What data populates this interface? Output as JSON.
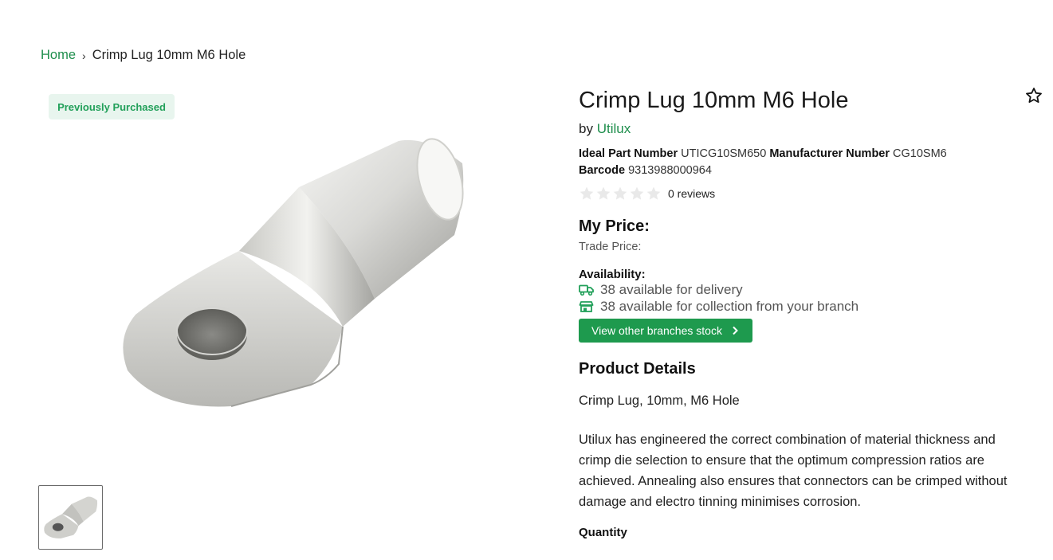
{
  "breadcrumb": {
    "home": "Home",
    "separator": "›",
    "current": "Crimp Lug 10mm M6 Hole"
  },
  "badge": "Previously Purchased",
  "product": {
    "title": "Crimp Lug 10mm M6 Hole",
    "by_prefix": "by",
    "brand": "Utilux",
    "ideal_part_label": "Ideal Part Number",
    "ideal_part_value": "UTICG10SM650",
    "manufacturer_label": "Manufacturer Number",
    "manufacturer_value": "CG10SM6",
    "barcode_label": "Barcode",
    "barcode_value": "9313988000964",
    "rating_stars": 0,
    "reviews": "0 reviews"
  },
  "pricing": {
    "my_price": "My Price:",
    "trade_price": "Trade Price:"
  },
  "availability": {
    "heading": "Availability:",
    "delivery": "38 available for delivery",
    "collection": "38 available for collection from your branch",
    "button": "View other branches stock"
  },
  "details": {
    "heading": "Product Details",
    "short": "Crimp Lug, 10mm, M6 Hole",
    "long": "Utilux has engineered the correct combination of material thickness and crimp die selection to ensure that the optimum compression ratios are achieved. Annealing also ensures that connectors can be crimped without damage and electro tinning minimises corrosion."
  },
  "quantity_label": "Quantity",
  "icons": {
    "favorite": "star-outline-icon",
    "delivery": "truck-icon",
    "collection": "store-icon",
    "chevron": "chevron-right-icon"
  },
  "colors": {
    "accent": "#1e8e4c",
    "button": "#1e9a4e",
    "badge_bg": "#e8f5ee"
  }
}
